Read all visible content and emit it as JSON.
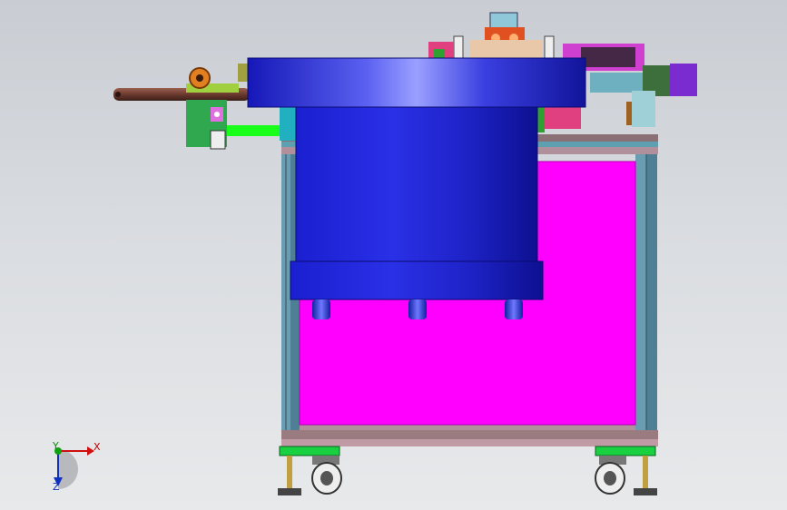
{
  "viewport": {
    "background_top": "#c9cdd3",
    "background_bottom": "#e8e9eb"
  },
  "model": {
    "components": [
      "cylindrical-feeder-bowl",
      "machine-frame",
      "magenta-side-panel",
      "feed-rod",
      "motor-assembly",
      "top-gripper-mechanism",
      "caster-wheels",
      "leveling-feet"
    ],
    "colors": {
      "bowl": "#2a2fd8",
      "bowl_highlight": "#8f95ff",
      "frame": "#5f8fa6",
      "panel": "#ff00ff",
      "rod": "#6b3a2e",
      "green_part": "#19c219",
      "base": "#9a7c80"
    }
  },
  "triad": {
    "x_label": "X",
    "y_label": "Y",
    "z_label": "Z",
    "x_color": "#d01010",
    "y_color": "#10a010",
    "z_color": "#1030c0"
  }
}
